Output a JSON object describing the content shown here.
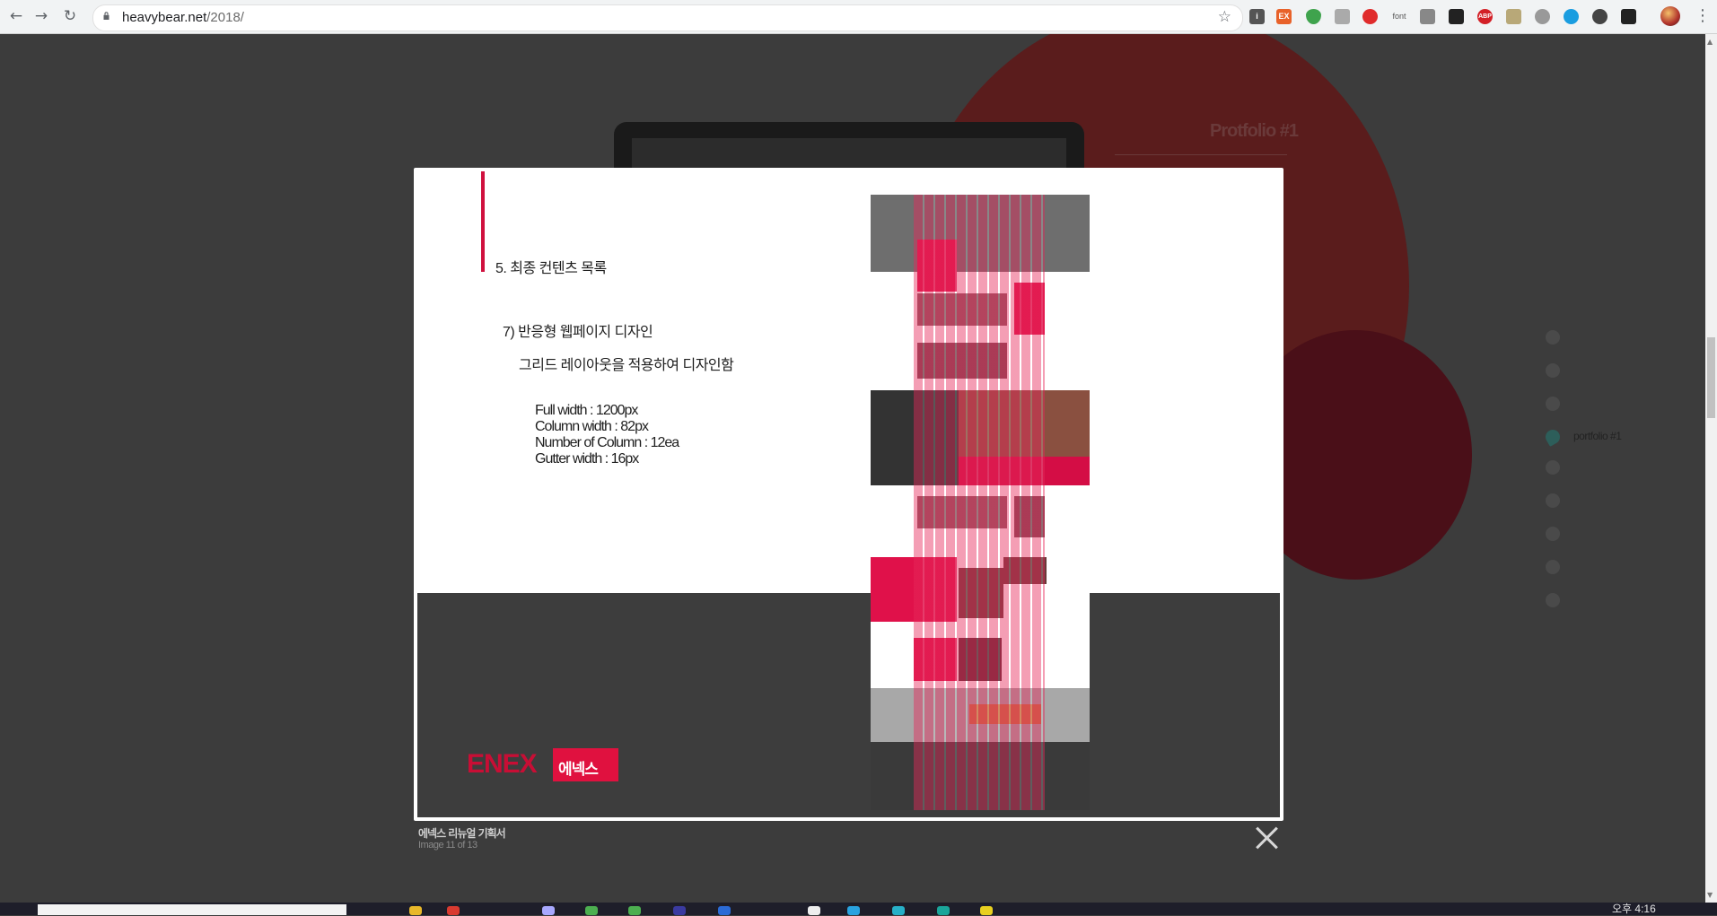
{
  "browser": {
    "url_host": "heavybear.net",
    "url_path": "/2018/",
    "extensions": [
      "i",
      "EX",
      "font",
      "ABP"
    ]
  },
  "background": {
    "heading": "Protfolio #1",
    "side_nav_active_label": "portfolio #1"
  },
  "lightbox": {
    "section_title": "5. 최종 컨텐츠 목록",
    "subsection_title": "7) 반응형 웹페이지 디자인",
    "description": "그리드 레이아웃을 적용하여 디자인함",
    "specs": [
      "Full width : 1200px",
      "Column width : 82px",
      "Number of Column : 12ea",
      "Gutter width : 16px"
    ],
    "logo_en": "ENEX",
    "logo_ko": "에넥스"
  },
  "caption": {
    "title": "에넥스 리뉴얼 기획서",
    "counter": "Image 11 of 13"
  },
  "taskbar": {
    "time": "오후 4:16"
  },
  "colors": {
    "accent": "#d0103e",
    "overlay": "#3d3d3d",
    "bg_circle": "#5a1c1c"
  }
}
